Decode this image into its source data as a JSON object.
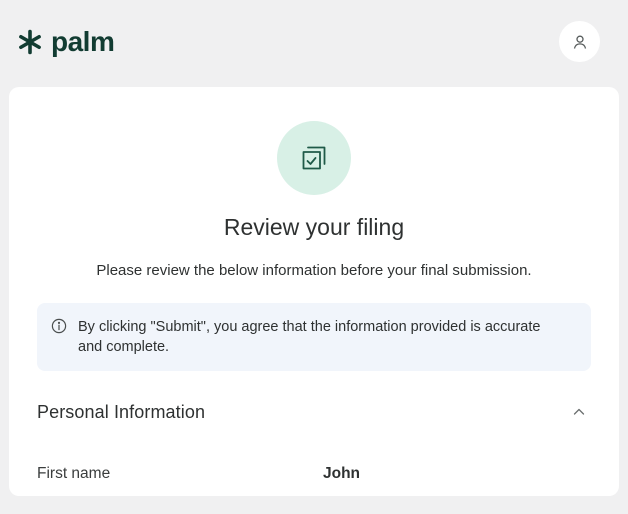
{
  "brand": {
    "name": "palm",
    "accent": "#123c32",
    "hero_bg": "#d8f0e6"
  },
  "header": {
    "user_icon": "user-icon"
  },
  "review": {
    "title": "Review your filing",
    "subtitle": "Please review the below information before your final submission.",
    "notice": "By clicking \"Submit\", you agree that the information provided is accurate and complete."
  },
  "section": {
    "title": "Personal Information",
    "toggle_icon": "chevron-up-icon",
    "fields": [
      {
        "label": "First name",
        "value": "John"
      }
    ]
  }
}
